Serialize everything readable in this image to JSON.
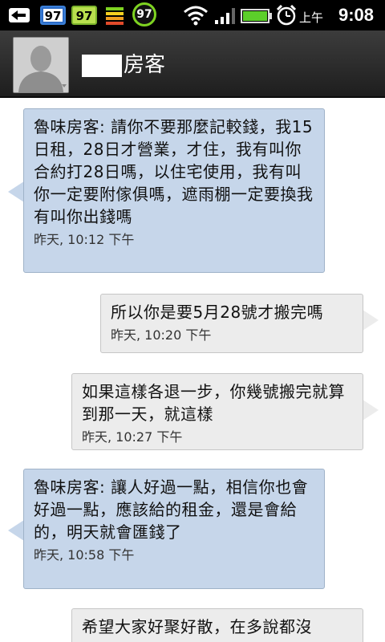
{
  "status_bar": {
    "badge_blue": "97",
    "badge_green": "97",
    "battery_level": "97",
    "ampm": "上午",
    "time": "9:08",
    "icons": [
      "back-arrow-icon",
      "notification-badge",
      "notification-badge",
      "signal-strength-bars-icon",
      "battery-circle-icon",
      "wifi-icon",
      "cell-signal-icon",
      "battery-icon",
      "alarm-clock-icon"
    ]
  },
  "header": {
    "contact_name_visible": "房客",
    "avatar_icon": "default-contact-silhouette"
  },
  "messages": [
    {
      "direction": "incoming",
      "text": "魯味房客: 請你不要那麼記較錢，我15日租，28日才營業，才住，我有叫你合約打28日嗎，以住宅使用，我有叫你一定要附傢俱嗎，遮雨棚一定要換我有叫你出錢嗎",
      "time": "昨天, 10:12 下午"
    },
    {
      "direction": "outgoing",
      "text": "所以你是要5月28號才搬完嗎",
      "time": "昨天, 10:20 下午"
    },
    {
      "direction": "outgoing",
      "text": "如果這樣各退一步，你幾號搬完就算到那一天，就這樣",
      "time": "昨天, 10:27 下午"
    },
    {
      "direction": "incoming",
      "text": "魯味房客: 讓人好過一點，相信你也會好過一點，應該給的租金，還是會給的，明天就會匯錢了",
      "time": "昨天, 10:58 下午"
    },
    {
      "direction": "outgoing",
      "text": "希望大家好聚好散，在多說都沒",
      "time": ""
    }
  ],
  "colors": {
    "incoming_bubble": "#c6d6ea",
    "outgoing_bubble": "#ececec",
    "header_bg": "#2b2b2b",
    "status_bar_bg": "#000000"
  }
}
